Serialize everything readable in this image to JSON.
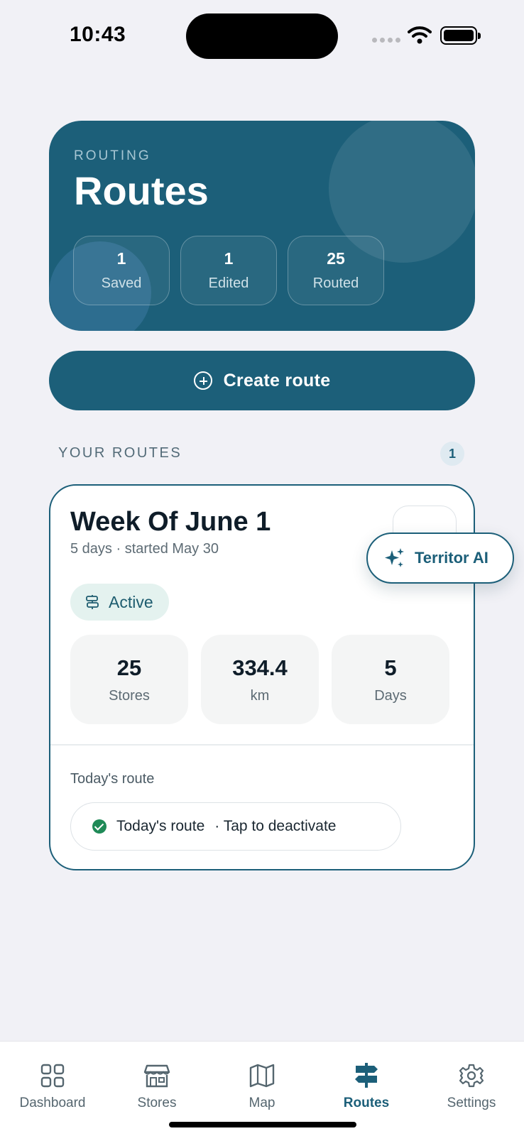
{
  "status_bar": {
    "time": "10:43"
  },
  "header": {
    "eyebrow": "ROUTING",
    "title": "Routes",
    "stats": [
      {
        "value": "1",
        "label": "Saved"
      },
      {
        "value": "1",
        "label": "Edited"
      },
      {
        "value": "25",
        "label": "Routed"
      }
    ]
  },
  "actions": {
    "create_route_label": "Create route"
  },
  "section": {
    "title": "YOUR ROUTES",
    "count": "1"
  },
  "route": {
    "title": "Week Of June 1",
    "subtitle": "5 days · started May 30",
    "status": "Active",
    "stats": [
      {
        "value": "25",
        "label": "Stores"
      },
      {
        "value": "334.4",
        "label": "km"
      },
      {
        "value": "5",
        "label": "Days"
      }
    ],
    "today_label": "Today's route",
    "today_pill_title": "Today's route",
    "today_pill_hint": "· Tap to deactivate"
  },
  "ai_button": {
    "label": "Territor AI"
  },
  "tabs": [
    {
      "label": "Dashboard",
      "icon": "grid-icon"
    },
    {
      "label": "Stores",
      "icon": "store-icon"
    },
    {
      "label": "Map",
      "icon": "map-icon"
    },
    {
      "label": "Routes",
      "icon": "signpost-icon",
      "active": true
    },
    {
      "label": "Settings",
      "icon": "gear-icon"
    }
  ],
  "colors": {
    "brand": "#1c5f79",
    "background": "#f1f1f6",
    "success": "#1f8a57",
    "active_badge_bg": "#e4f2ef"
  }
}
